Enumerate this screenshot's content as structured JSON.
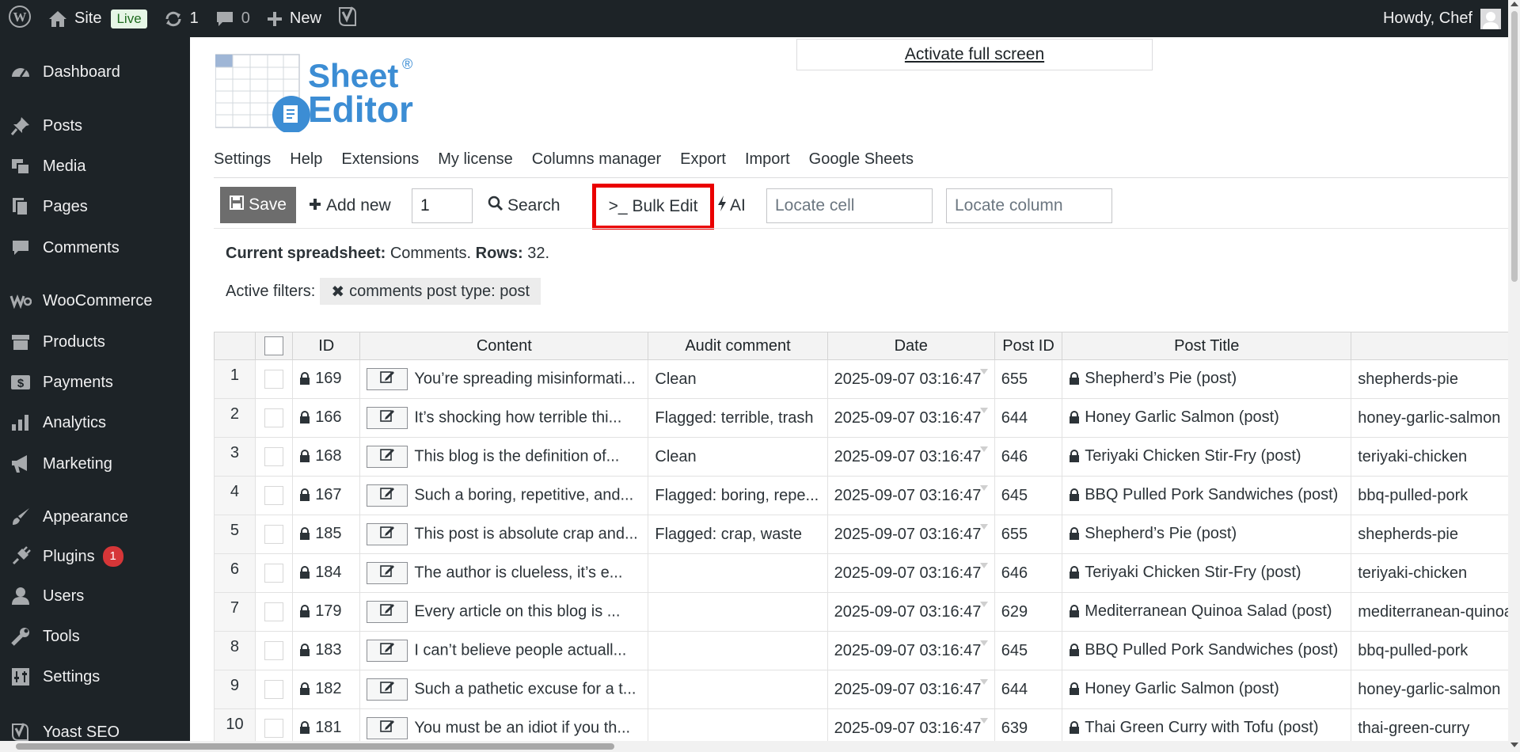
{
  "admin_bar": {
    "site_label": "Site",
    "live_label": "Live",
    "updates_count": "1",
    "comments_count": "0",
    "new_label": "New",
    "greeting": "Howdy, Chef"
  },
  "sidebar": {
    "items": [
      {
        "label": "Dashboard",
        "icon": "dashboard-icon"
      },
      {
        "label": "Posts",
        "icon": "pin-icon"
      },
      {
        "label": "Media",
        "icon": "media-icon"
      },
      {
        "label": "Pages",
        "icon": "pages-icon"
      },
      {
        "label": "Comments",
        "icon": "comment-icon"
      },
      {
        "label": "WooCommerce",
        "icon": "woocommerce-icon"
      },
      {
        "label": "Products",
        "icon": "archive-icon"
      },
      {
        "label": "Payments",
        "icon": "dollar-icon"
      },
      {
        "label": "Analytics",
        "icon": "bar-chart-icon"
      },
      {
        "label": "Marketing",
        "icon": "megaphone-icon"
      },
      {
        "label": "Appearance",
        "icon": "paintbrush-icon"
      },
      {
        "label": "Plugins",
        "icon": "plug-icon",
        "badge": "1"
      },
      {
        "label": "Users",
        "icon": "user-icon"
      },
      {
        "label": "Tools",
        "icon": "wrench-icon"
      },
      {
        "label": "Settings",
        "icon": "settings-sliders-icon"
      },
      {
        "label": "Yoast SEO",
        "icon": "yoast-icon"
      }
    ]
  },
  "fullscreen_link": "Activate full screen",
  "logo": {
    "line1": "Sheet",
    "line2": "Editor",
    "registered": "®"
  },
  "top_nav": [
    "Settings",
    "Help",
    "Extensions",
    "My license",
    "Columns manager",
    "Export",
    "Import",
    "Google Sheets"
  ],
  "toolbar": {
    "save_label": "Save",
    "add_new_label": "Add new",
    "add_new_count": "1",
    "search_label": "Search",
    "bulk_edit_label": "Bulk Edit",
    "bulk_edit_prefix": ">_",
    "ai_label": "AI",
    "locate_cell_placeholder": "Locate cell",
    "locate_column_placeholder": "Locate column"
  },
  "status": {
    "spreadsheet_label": "Current spreadsheet:",
    "spreadsheet_value": "Comments.",
    "rows_label": "Rows:",
    "rows_value": "32."
  },
  "filters": {
    "label": "Active filters:",
    "chips": [
      "comments post type: post"
    ]
  },
  "table": {
    "columns": [
      "ID",
      "Content",
      "Audit comment",
      "Date",
      "Post ID",
      "Post Title"
    ],
    "rows": [
      {
        "num": "1",
        "id": "169",
        "content": "You’re spreading misinformati...",
        "audit": "Clean",
        "date": "2025-09-07 03:16:47",
        "post_id": "655",
        "post_title": "Shepherd’s Pie (post)",
        "slug": "shepherds-pie"
      },
      {
        "num": "2",
        "id": "166",
        "content": "It’s shocking how terrible thi...",
        "audit": "Flagged: terrible, trash",
        "date": "2025-09-07 03:16:47",
        "post_id": "644",
        "post_title": "Honey Garlic Salmon (post)",
        "slug": "honey-garlic-salmon"
      },
      {
        "num": "3",
        "id": "168",
        "content": "This blog is the definition of...",
        "audit": "Clean",
        "date": "2025-09-07 03:16:47",
        "post_id": "646",
        "post_title": "Teriyaki Chicken Stir-Fry (post)",
        "slug": "teriyaki-chicken"
      },
      {
        "num": "4",
        "id": "167",
        "content": "Such a boring, repetitive, and...",
        "audit": "Flagged: boring, repe...",
        "date": "2025-09-07 03:16:47",
        "post_id": "645",
        "post_title": "BBQ Pulled Pork Sandwiches (post)",
        "slug": "bbq-pulled-pork"
      },
      {
        "num": "5",
        "id": "185",
        "content": "This post is absolute crap and...",
        "audit": "Flagged: crap, waste",
        "date": "2025-09-07 03:16:47",
        "post_id": "655",
        "post_title": "Shepherd’s Pie (post)",
        "slug": "shepherds-pie"
      },
      {
        "num": "6",
        "id": "184",
        "content": "The author is clueless, it’s e...",
        "audit": "",
        "date": "2025-09-07 03:16:47",
        "post_id": "646",
        "post_title": "Teriyaki Chicken Stir-Fry (post)",
        "slug": "teriyaki-chicken"
      },
      {
        "num": "7",
        "id": "179",
        "content": "Every article on this blog is ...",
        "audit": "",
        "date": "2025-09-07 03:16:47",
        "post_id": "629",
        "post_title": "Mediterranean Quinoa Salad (post)",
        "slug": "mediterranean-quinoa"
      },
      {
        "num": "8",
        "id": "183",
        "content": "I can’t believe people actuall...",
        "audit": "",
        "date": "2025-09-07 03:16:47",
        "post_id": "645",
        "post_title": "BBQ Pulled Pork Sandwiches (post)",
        "slug": "bbq-pulled-pork"
      },
      {
        "num": "9",
        "id": "182",
        "content": "Such a pathetic excuse for a t...",
        "audit": "",
        "date": "2025-09-07 03:16:47",
        "post_id": "644",
        "post_title": "Honey Garlic Salmon (post)",
        "slug": "honey-garlic-salmon"
      },
      {
        "num": "10",
        "id": "181",
        "content": "You must be an idiot if you th...",
        "audit": "",
        "date": "2025-09-07 03:16:47",
        "post_id": "639",
        "post_title": "Thai Green Curry with Tofu (post)",
        "slug": "thai-green-curry"
      }
    ]
  }
}
